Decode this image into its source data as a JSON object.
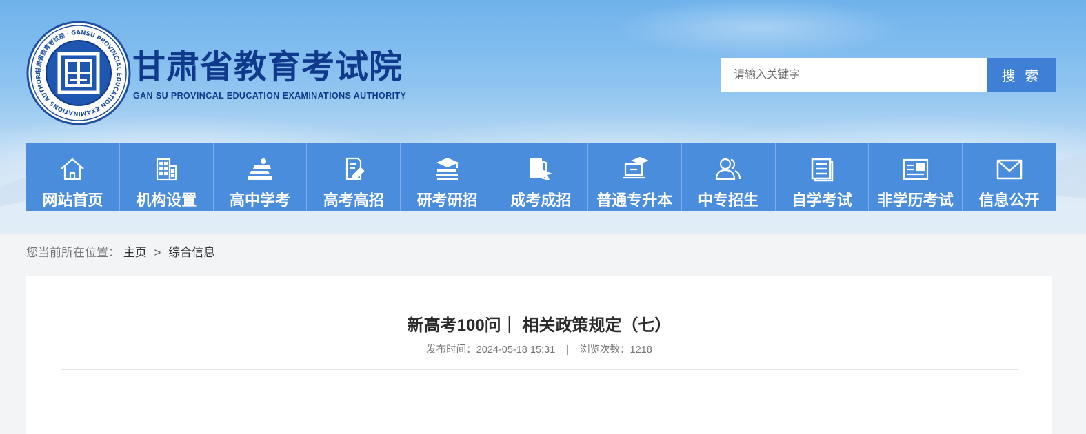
{
  "header": {
    "site_name": "甘肃省教育考试院",
    "site_name_en": "GAN SU PROVINCAL EDUCATION EXAMINATIONS AUTHORITY",
    "logo_ring_text": "甘肃省教育考试院 · GANSU PROVINCIAL EDUCATION EXAMINATIONS AUTHORITY ·"
  },
  "search": {
    "placeholder": "请输入关键字",
    "button_label": "搜 索"
  },
  "nav": {
    "items": [
      {
        "label": "网站首页",
        "icon": "home-icon"
      },
      {
        "label": "机构设置",
        "icon": "building-icon"
      },
      {
        "label": "高中学考",
        "icon": "books-icon"
      },
      {
        "label": "高考高招",
        "icon": "document-pen-icon"
      },
      {
        "label": "研考研招",
        "icon": "graduation-cap-icon"
      },
      {
        "label": "成考成招",
        "icon": "book-cursor-icon"
      },
      {
        "label": "普通专升本",
        "icon": "laptop-cap-icon"
      },
      {
        "label": "中专招生",
        "icon": "users-icon"
      },
      {
        "label": "自学考试",
        "icon": "list-document-icon"
      },
      {
        "label": "非学历考试",
        "icon": "id-card-icon"
      },
      {
        "label": "信息公开",
        "icon": "mail-icon"
      }
    ]
  },
  "breadcrumb": {
    "label": "您当前所在位置：",
    "home": "主页",
    "separator": ">",
    "current": "综合信息"
  },
  "article": {
    "title": "新高考100问｜ 相关政策规定（七）",
    "publish_label": "发布时间：",
    "publish_time": "2024-05-18 15:31",
    "separator": "|",
    "views_label": "浏览次数：",
    "views": "1218"
  },
  "colors": {
    "nav_bg": "#4a8ddc",
    "brand_dark_blue": "#0f3a8c",
    "search_button": "#3f7fd5"
  }
}
